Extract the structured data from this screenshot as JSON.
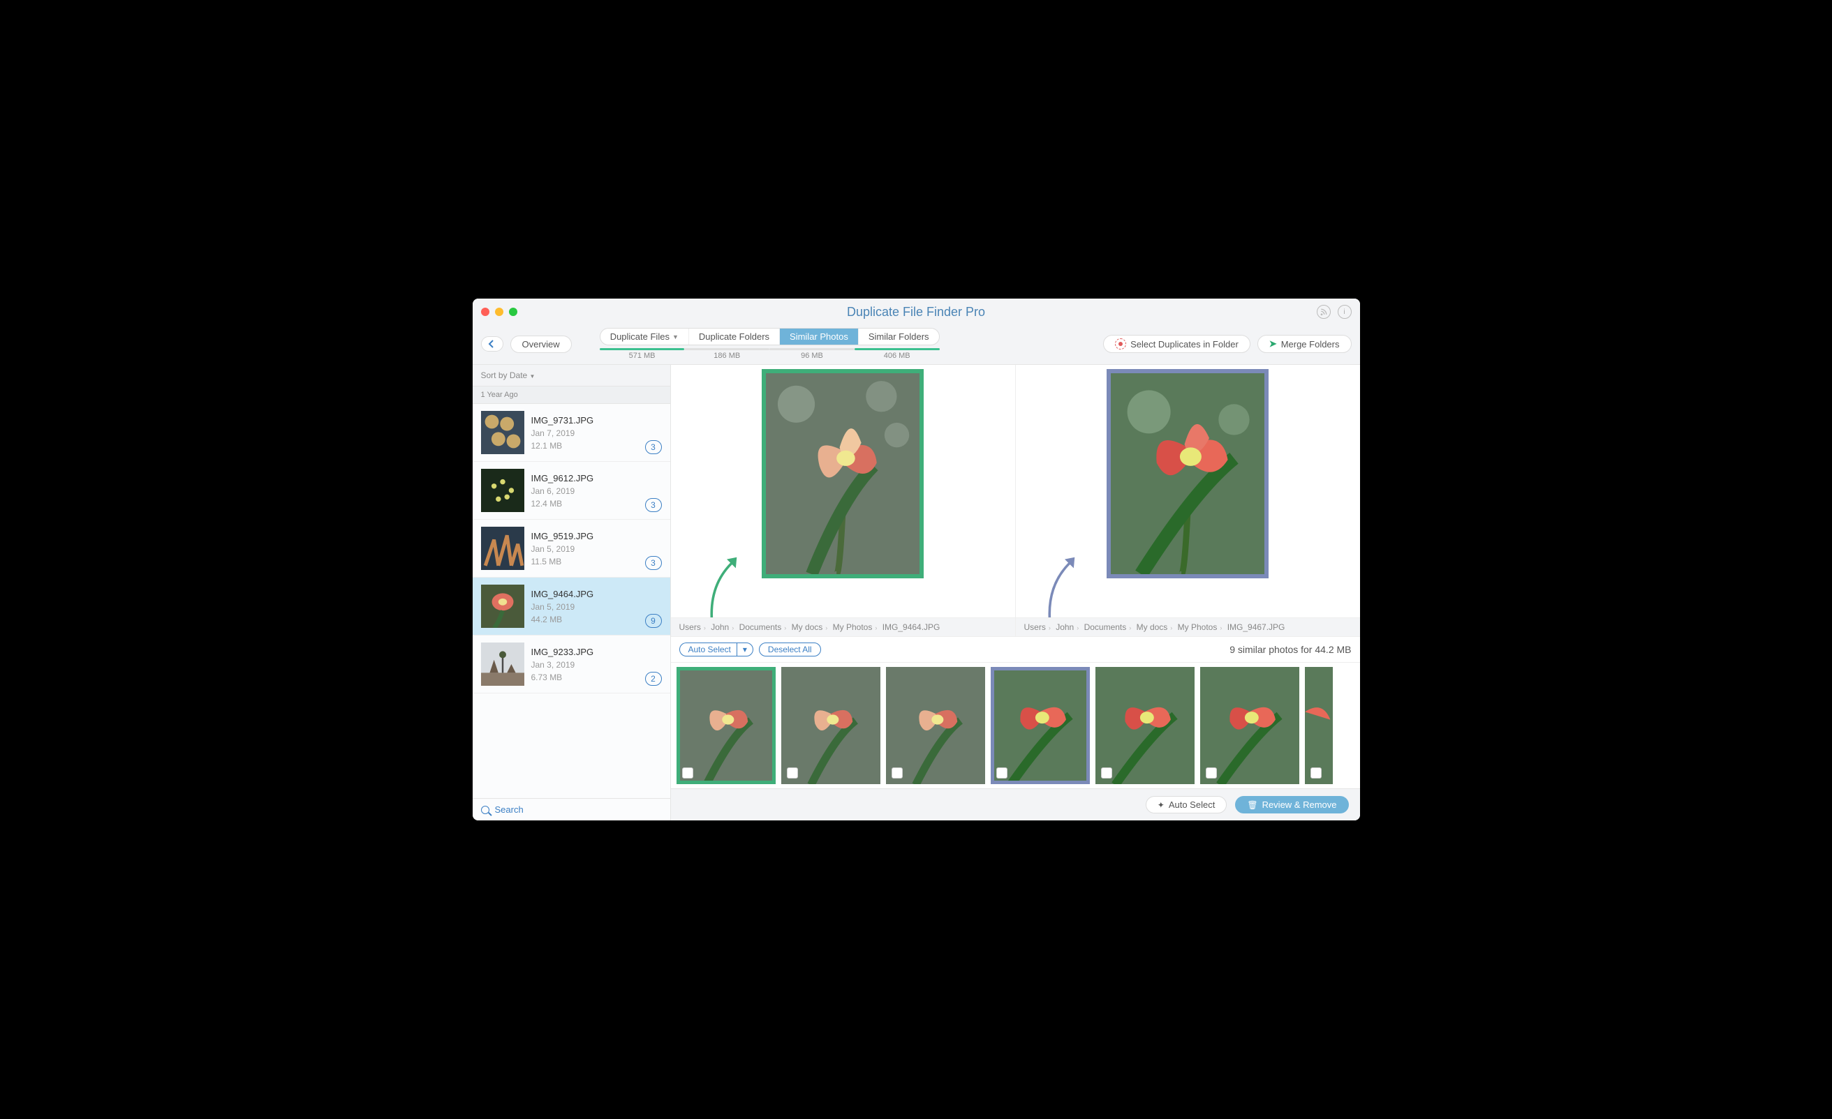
{
  "app_title": "Duplicate File Finder Pro",
  "toolbar": {
    "overview": "Overview",
    "tabs": [
      {
        "label": "Duplicate Files",
        "size": "571 MB",
        "fill": 100,
        "dropdown": true
      },
      {
        "label": "Duplicate Folders",
        "size": "186 MB",
        "fill": 0
      },
      {
        "label": "Similar Photos",
        "size": "96 MB",
        "fill": 0,
        "active": true
      },
      {
        "label": "Similar Folders",
        "size": "406 MB",
        "fill": 100
      }
    ],
    "select_dupes": "Select Duplicates in Folder",
    "merge": "Merge Folders"
  },
  "sidebar": {
    "sort_label": "Sort by Date",
    "group": "1 Year Ago",
    "items": [
      {
        "name": "IMG_9731.JPG",
        "date": "Jan 7, 2019",
        "size": "12.1 MB",
        "count": "3"
      },
      {
        "name": "IMG_9612.JPG",
        "date": "Jan 6, 2019",
        "size": "12.4 MB",
        "count": "3"
      },
      {
        "name": "IMG_9519.JPG",
        "date": "Jan 5, 2019",
        "size": "11.5 MB",
        "count": "3"
      },
      {
        "name": "IMG_9464.JPG",
        "date": "Jan 5, 2019",
        "size": "44.2 MB",
        "count": "9",
        "selected": true
      },
      {
        "name": "IMG_9233.JPG",
        "date": "Jan 3, 2019",
        "size": "6.73 MB",
        "count": "2"
      }
    ],
    "search": "Search"
  },
  "compare": {
    "left_path": [
      "Users",
      "John",
      "Documents",
      "My docs",
      "My Photos",
      "IMG_9464.JPG"
    ],
    "right_path": [
      "Users",
      "John",
      "Documents",
      "My docs",
      "My Photos",
      "IMG_9467.JPG"
    ]
  },
  "actions": {
    "auto_select": "Auto Select",
    "deselect_all": "Deselect All",
    "summary": "9 similar photos for 44.2 MB"
  },
  "footer": {
    "auto_select": "Auto Select",
    "review": "Review & Remove"
  }
}
